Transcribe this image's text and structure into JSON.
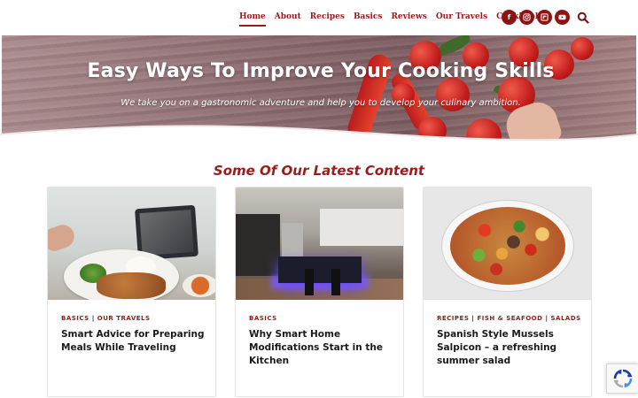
{
  "nav": {
    "items": [
      {
        "label": "Home",
        "active": true
      },
      {
        "label": "About"
      },
      {
        "label": "Recipes"
      },
      {
        "label": "Basics"
      },
      {
        "label": "Reviews"
      },
      {
        "label": "Our Travels"
      },
      {
        "label": "Cookbook"
      }
    ]
  },
  "socials": [
    {
      "name": "facebook-icon",
      "glyph": "f"
    },
    {
      "name": "instagram-icon"
    },
    {
      "name": "flipboard-icon"
    },
    {
      "name": "youtube-icon"
    }
  ],
  "colors": {
    "accent": "#9b1b1b"
  },
  "hero": {
    "title": "Easy Ways To Improve Your Cooking Skills",
    "subtitle": "We take you on a gastronomic adventure and help you to develop your culinary ambition."
  },
  "section": {
    "title": "Some Of Our Latest Content"
  },
  "cards": [
    {
      "categories": [
        "BASICS",
        "OUR TRAVELS"
      ],
      "title": "Smart Advice for Preparing Meals While Traveling"
    },
    {
      "categories": [
        "BASICS"
      ],
      "title": "Why Smart Home Modifications Start in the Kitchen"
    },
    {
      "categories": [
        "RECIPES",
        "FISH & SEAFOOD",
        "SALADS"
      ],
      "title": "Spanish Style Mussels Salpicon – a refreshing summer salad"
    }
  ]
}
